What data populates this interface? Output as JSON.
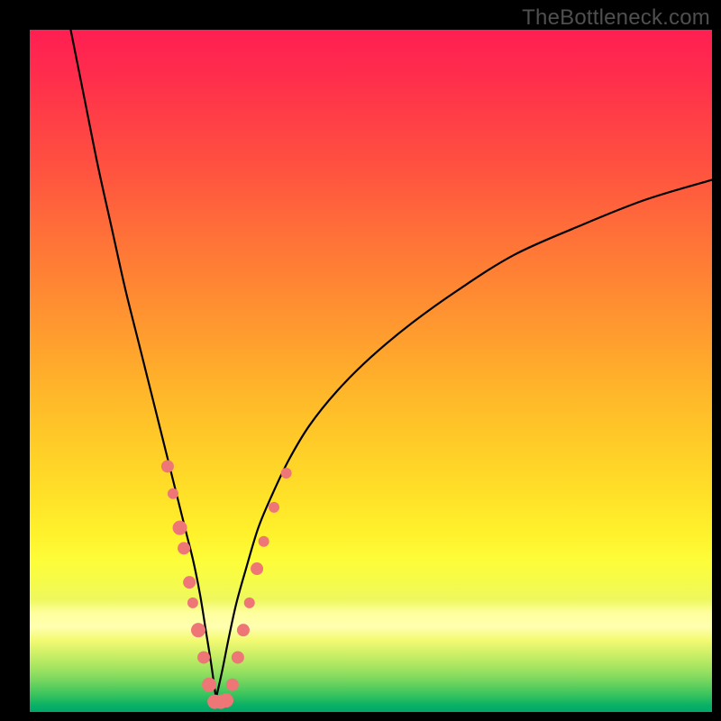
{
  "branding": {
    "watermark": "TheBottleneck.com"
  },
  "chart_data": {
    "type": "line",
    "title": "",
    "xlabel": "",
    "ylabel": "",
    "xlim": [
      0,
      100
    ],
    "ylim": [
      0,
      100
    ],
    "grid": false,
    "legend": false,
    "series": [
      {
        "name": "left-curve",
        "x": [
          6,
          8,
          10,
          12,
          14,
          16,
          17,
          18,
          19,
          20,
          21,
          22,
          23,
          24,
          25,
          25.8,
          26.6,
          27.3
        ],
        "y": [
          100,
          90,
          80,
          71,
          62,
          54,
          50,
          46,
          42,
          38,
          34,
          30,
          26,
          22,
          17,
          12,
          7,
          2
        ]
      },
      {
        "name": "right-curve",
        "x": [
          27.3,
          28.2,
          29.2,
          30.3,
          31.7,
          33.5,
          35.6,
          38.0,
          41.0,
          45.0,
          50.0,
          56.0,
          63.0,
          71.0,
          80.0,
          90.0,
          100.0
        ],
        "y": [
          2,
          6,
          11,
          16,
          21,
          27,
          32,
          37,
          42,
          47,
          52,
          57,
          62,
          67,
          71,
          75,
          78
        ]
      }
    ],
    "scatter_overlay": {
      "name": "data-points",
      "color": "#ef7676",
      "points": [
        {
          "x": 20.2,
          "y": 36,
          "r": 7
        },
        {
          "x": 21.0,
          "y": 32,
          "r": 6
        },
        {
          "x": 22.0,
          "y": 27,
          "r": 8
        },
        {
          "x": 22.6,
          "y": 24,
          "r": 7
        },
        {
          "x": 23.4,
          "y": 19,
          "r": 7
        },
        {
          "x": 23.9,
          "y": 16,
          "r": 6
        },
        {
          "x": 24.7,
          "y": 12,
          "r": 8
        },
        {
          "x": 25.5,
          "y": 8,
          "r": 7
        },
        {
          "x": 26.3,
          "y": 4,
          "r": 8
        },
        {
          "x": 27.1,
          "y": 1.5,
          "r": 8
        },
        {
          "x": 28.0,
          "y": 1.5,
          "r": 8
        },
        {
          "x": 28.8,
          "y": 1.7,
          "r": 8
        },
        {
          "x": 29.7,
          "y": 4,
          "r": 7
        },
        {
          "x": 30.5,
          "y": 8,
          "r": 7
        },
        {
          "x": 31.3,
          "y": 12,
          "r": 7
        },
        {
          "x": 32.2,
          "y": 16,
          "r": 6
        },
        {
          "x": 33.3,
          "y": 21,
          "r": 7
        },
        {
          "x": 34.3,
          "y": 25,
          "r": 6
        },
        {
          "x": 35.8,
          "y": 30,
          "r": 6
        },
        {
          "x": 37.6,
          "y": 35,
          "r": 6
        }
      ]
    }
  }
}
